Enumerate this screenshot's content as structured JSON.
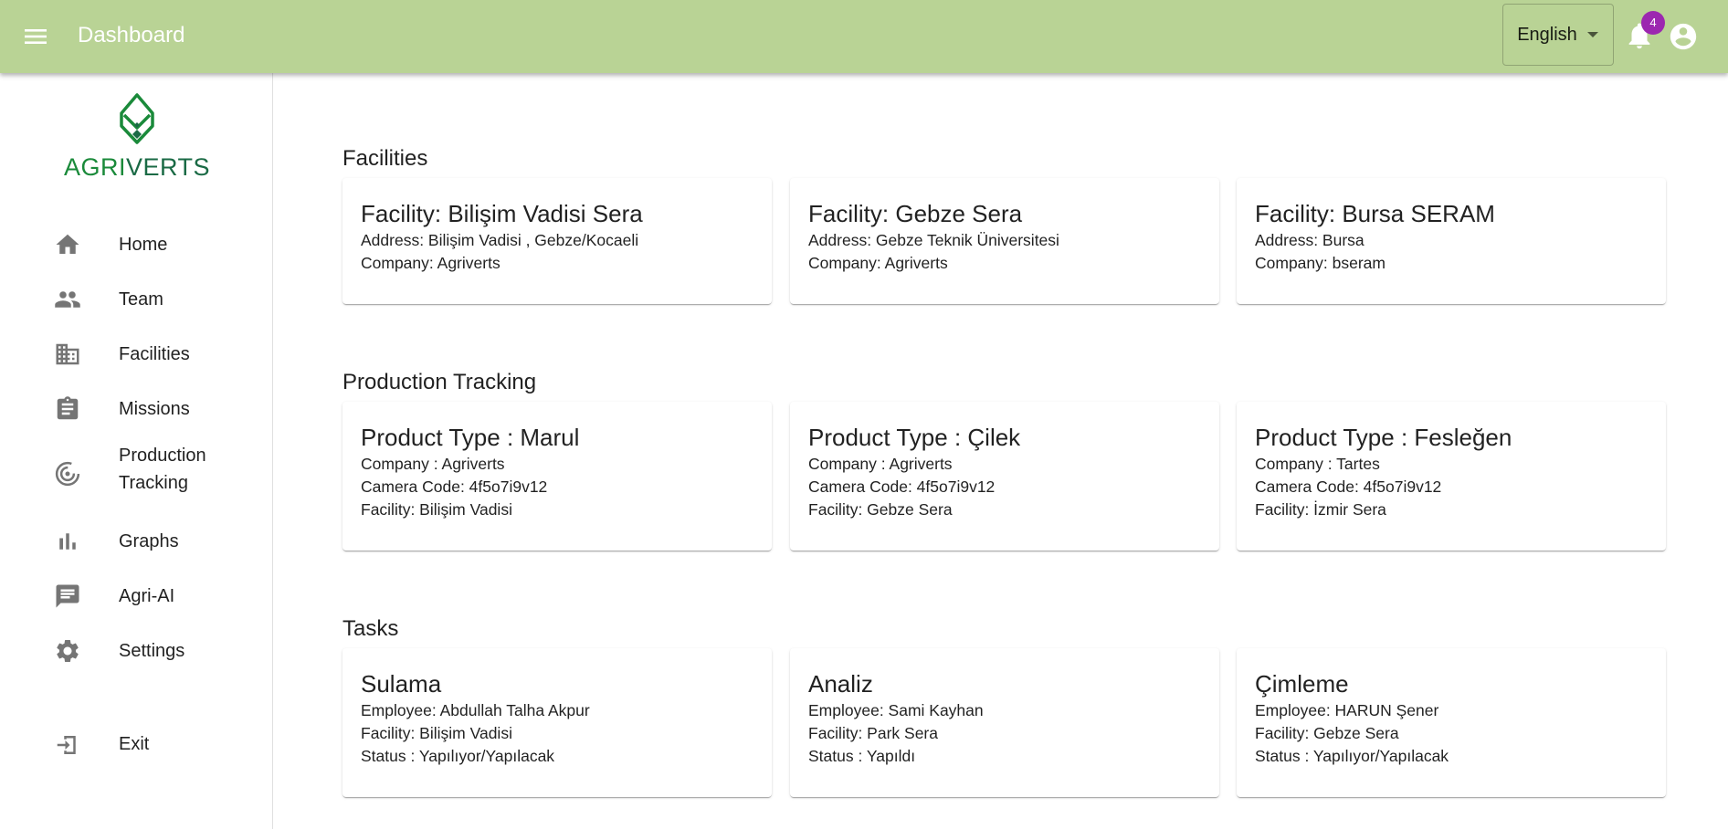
{
  "appbar": {
    "title": "Dashboard",
    "language": "English",
    "notification_count": "4",
    "color": "#b9d395"
  },
  "sidebar": {
    "logo": {
      "part1": "AGRI",
      "part2": "VERTS"
    },
    "items": [
      {
        "label": "Home",
        "icon": "home-icon"
      },
      {
        "label": "Team",
        "icon": "people-icon"
      },
      {
        "label": "Facilities",
        "icon": "building-icon"
      },
      {
        "label": "Missions",
        "icon": "assignment-icon"
      },
      {
        "label": "Production Tracking",
        "label_line1": "Production",
        "label_line2": "Tracking",
        "icon": "target-icon"
      },
      {
        "label": "Graphs",
        "icon": "bar-chart-icon"
      },
      {
        "label": "Agri-AI",
        "icon": "chat-icon"
      },
      {
        "label": "Settings",
        "icon": "gear-icon"
      },
      {
        "label": "Exit",
        "icon": "exit-icon"
      }
    ]
  },
  "sections": {
    "facilities": {
      "title": "Facilities",
      "cards": [
        {
          "title": "Facility: Bilişim Vadisi Sera",
          "lines": [
            "Address: Bilişim Vadisi , Gebze/Kocaeli",
            "Company: Agriverts"
          ]
        },
        {
          "title": "Facility: Gebze Sera",
          "lines": [
            "Address: Gebze Teknik Üniversitesi",
            "Company: Agriverts"
          ]
        },
        {
          "title": "Facility: Bursa SERAM",
          "lines": [
            "Address: Bursa",
            "Company: bseram"
          ]
        }
      ]
    },
    "production": {
      "title": "Production Tracking",
      "cards": [
        {
          "title": "Product Type : Marul",
          "lines": [
            "Company : Agriverts",
            "Camera Code: 4f5o7i9v12",
            "Facility: Bilişim Vadisi"
          ]
        },
        {
          "title": "Product Type : Çilek",
          "lines": [
            "Company : Agriverts",
            "Camera Code: 4f5o7i9v12",
            "Facility: Gebze Sera"
          ]
        },
        {
          "title": "Product Type : Fesleğen",
          "lines": [
            "Company : Tartes",
            "Camera Code: 4f5o7i9v12",
            "Facility: İzmir Sera"
          ]
        }
      ]
    },
    "tasks": {
      "title": "Tasks",
      "cards": [
        {
          "title": "Sulama",
          "lines": [
            "Employee: Abdullah Talha Akpur",
            "Facility: Bilişim Vadisi",
            "Status : Yapılıyor/Yapılacak"
          ]
        },
        {
          "title": "Analiz",
          "lines": [
            "Employee: Sami Kayhan",
            "Facility: Park Sera",
            "Status : Yapıldı"
          ]
        },
        {
          "title": "Çimleme",
          "lines": [
            "Employee: HARUN Şener",
            "Facility: Gebze Sera",
            "Status : Yapılıyor/Yapılacak"
          ]
        }
      ]
    }
  }
}
